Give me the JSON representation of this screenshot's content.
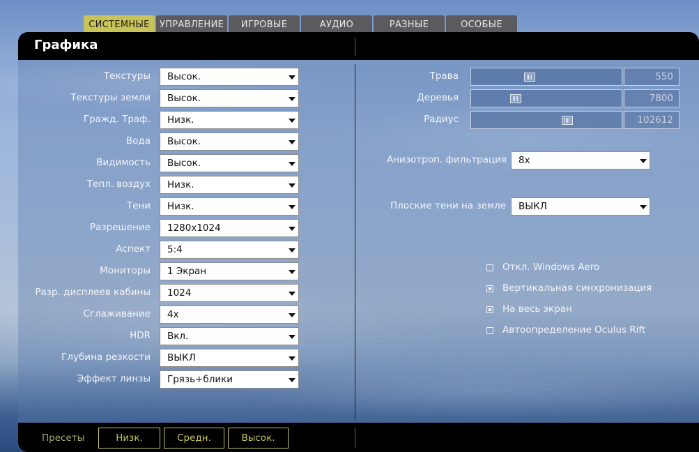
{
  "tabs": [
    {
      "label": "СИСТЕМНЫЕ",
      "active": true
    },
    {
      "label": "УПРАВЛЕНИЕ",
      "active": false
    },
    {
      "label": "ИГРОВЫЕ",
      "active": false
    },
    {
      "label": "АУДИО",
      "active": false
    },
    {
      "label": "РАЗНЫЕ",
      "active": false
    },
    {
      "label": "ОСОБЫЕ",
      "active": false
    }
  ],
  "panel": {
    "title": "Графика"
  },
  "left_settings": [
    {
      "label": "Текстуры",
      "value": "Высок."
    },
    {
      "label": "Текстуры земли",
      "value": "Высок."
    },
    {
      "label": "Гражд. Траф.",
      "value": "Низк."
    },
    {
      "label": "Вода",
      "value": "Высок."
    },
    {
      "label": "Видимость",
      "value": "Высок."
    },
    {
      "label": "Тепл. воздух",
      "value": "Низк."
    },
    {
      "label": "Тени",
      "value": "Низк."
    },
    {
      "label": "Разрешение",
      "value": "1280x1024"
    },
    {
      "label": "Аспект",
      "value": "5:4"
    },
    {
      "label": "Мониторы",
      "value": "1 Экран"
    },
    {
      "label": "Разр. дисплеев кабины",
      "value": "1024"
    },
    {
      "label": "Сглаживание",
      "value": "4x"
    },
    {
      "label": "HDR",
      "value": "Вкл."
    },
    {
      "label": "Глубина резкости",
      "value": "ВЫКЛ"
    },
    {
      "label": "Эффект линзы",
      "value": "Грязь+блики"
    }
  ],
  "sliders": [
    {
      "label": "Трава",
      "value": "550",
      "level": 0.38
    },
    {
      "label": "Деревья",
      "value": "7800",
      "level": 0.28
    },
    {
      "label": "Радиус",
      "value": "102612",
      "level": 0.65
    }
  ],
  "right_selects": {
    "aniso": {
      "label": "Анизотроп. фильтрация",
      "value": "8x"
    },
    "flat_shadows": {
      "label": "Плоские тени на земле",
      "value": "ВЫКЛ"
    }
  },
  "checkboxes": [
    {
      "label": "Откл. Windows Aero",
      "checked": false
    },
    {
      "label": "Вертикальная синхронизация",
      "checked": true
    },
    {
      "label": "На весь экран",
      "checked": true
    },
    {
      "label": "Автоопределение Oculus Rift",
      "checked": false
    }
  ],
  "footer": {
    "presets_label": "Пресеты",
    "buttons": [
      "Низк.",
      "Средн.",
      "Высок."
    ]
  },
  "colors": {
    "accent": "#c8c45a",
    "tab_bg": "#5b5b5f",
    "header_bg": "#000000"
  }
}
